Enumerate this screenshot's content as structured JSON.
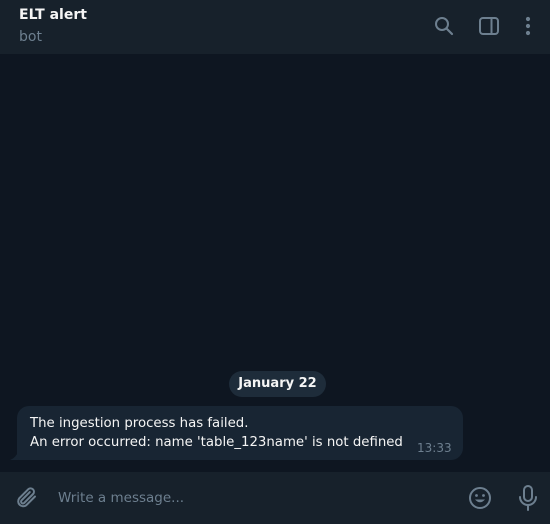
{
  "header": {
    "title": "ELT alert",
    "subtitle": "bot",
    "icons": [
      "search-icon",
      "side-panel-icon",
      "more-vertical-icon"
    ]
  },
  "messages": {
    "date_label": "January 22",
    "items": [
      {
        "lines": [
          "The ingestion process has failed.",
          "An error occurred: name 'table_123name' is not defined"
        ],
        "time": "13:33"
      }
    ]
  },
  "composer": {
    "placeholder": "Write a message...",
    "value": "",
    "icons": [
      "paperclip-icon",
      "emoji-icon",
      "microphone-icon"
    ]
  },
  "colors": {
    "background": "#0e1621",
    "panel": "#17212b",
    "bubble": "#182533",
    "text": "#f5f5f5",
    "muted": "#6d7f8f",
    "icon": "#6d7f8f"
  }
}
